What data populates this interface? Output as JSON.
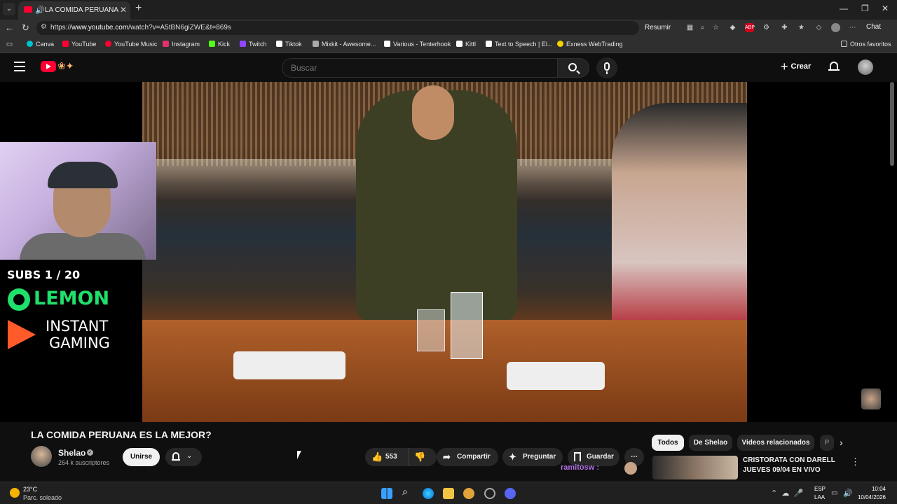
{
  "browser": {
    "tab_title": "LA COMIDA PERUANA ES LA",
    "url_prefix": "https://",
    "url_domain": "www.youtube.com",
    "url_path": "/watch?v=A5tBN6giZWE&t=869s",
    "summary_label": "Resumir",
    "chat_label": "Chat"
  },
  "bookmarks": [
    {
      "label": "Canva",
      "color": "#00c4cc"
    },
    {
      "label": "YouTube",
      "color": "#ff0033"
    },
    {
      "label": "YouTube Music",
      "color": "#ff0033"
    },
    {
      "label": "Instagram",
      "color": "#e1306c"
    },
    {
      "label": "Kick",
      "color": "#53fc18"
    },
    {
      "label": "Twitch",
      "color": "#9146ff"
    },
    {
      "label": "Tiktok",
      "color": "#ffffff"
    },
    {
      "label": "Mixkit - Awesome...",
      "color": "#aaaaaa"
    },
    {
      "label": "Various - Tenterhook",
      "color": "#ffffff"
    },
    {
      "label": "Kittl",
      "color": "#ffffff"
    },
    {
      "label": "Text to Speech | El...",
      "color": "#ffffff"
    },
    {
      "label": "Exness WebTrading",
      "color": "#f4d300"
    }
  ],
  "other_bookmarks": "Otros favoritos",
  "header": {
    "search_placeholder": "Buscar",
    "create_label": "Crear"
  },
  "overlay": {
    "subs": "SUBS 1 / 20",
    "lemon": "LEMON",
    "instant": "INSTANT",
    "gaming": "GAMING"
  },
  "video": {
    "title": "LA COMIDA PERUANA ES LA MEJOR?",
    "channel": "Shelao",
    "subscribers": "264 k suscriptores",
    "join_label": "Unirse",
    "likes": "553",
    "share_label": "Compartir",
    "ask_label": "Preguntar",
    "save_label": "Guardar",
    "chat_user": "ramitosw :"
  },
  "chips": [
    "Todos",
    "De Shelao",
    "Videos relacionados",
    "P"
  ],
  "recommended": {
    "line1": "CRISTORATA CON DARELL",
    "line2": "JUEVES 09/04 EN VIVO"
  },
  "taskbar": {
    "temp": "23°C",
    "condition": "Parc. soleado",
    "lang1": "ESP",
    "lang2": "LAA",
    "time": "10:04",
    "date": "10/04/2026"
  }
}
